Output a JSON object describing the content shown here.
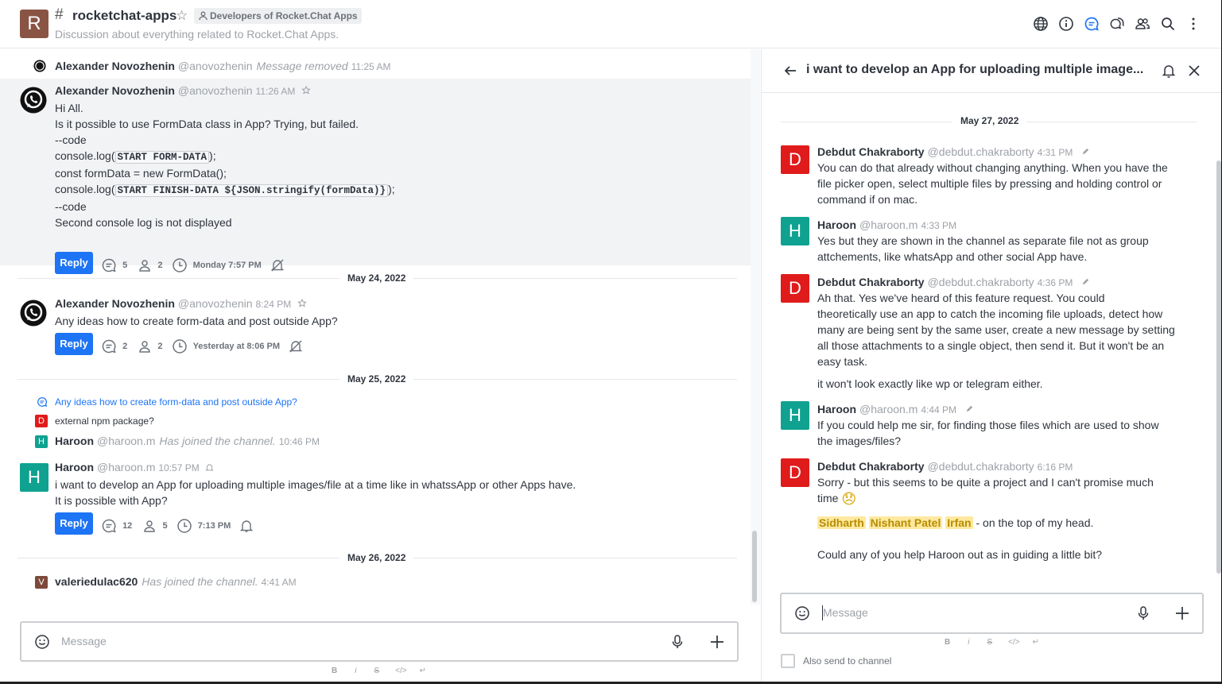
{
  "room": {
    "avatar_letter": "R",
    "name": "rocketchat-apps",
    "team": "Developers of Rocket.Chat Apps",
    "topic": "Discussion about everything related to Rocket.Chat Apps.",
    "header_icons": [
      "globe-icon",
      "info-icon",
      "threads-icon",
      "discussions-icon",
      "members-icon",
      "search-icon",
      "kebab-icon"
    ]
  },
  "main": {
    "messages": [
      {
        "name": "Alexander Novozhenin",
        "username": "@anovozhenin",
        "system": "Message removed",
        "time": "11:25 AM"
      },
      {
        "name": "Alexander Novozhenin",
        "username": "@anovozhenin",
        "time": "11:26 AM",
        "lines": [
          "Hi All.",
          "Is it possible to use FormData class in App? Trying, but failed.",
          "--code"
        ],
        "code1_pre": "console.log(",
        "code1": "START FORM-DATA",
        "code1_post": ");",
        "line_form": "const formData = new FormData();",
        "code2_pre": "console.log(",
        "code2": "START FINISH-DATA ${JSON.stringify(formData)}",
        "code2_post": ");",
        "lines2": [
          "--code",
          "Second console log is not displayed"
        ],
        "reply": "Reply",
        "replies": "5",
        "participants": "2",
        "last": "Monday 7:57 PM"
      },
      {
        "name": "Alexander Novozhenin",
        "username": "@anovozhenin",
        "time": "8:24 PM",
        "text": "Any ideas how to create form-data and post outside App?",
        "reply": "Reply",
        "replies": "2",
        "participants": "2",
        "last": "Yesterday at 8:06 PM"
      },
      {
        "thread_link": "Any ideas how to create form-data and post outside App?",
        "avatar_letter": "D",
        "text": "external npm package?"
      },
      {
        "avatar_letter": "H",
        "name": "Haroon",
        "username": "@haroon.m",
        "system": "Has joined the channel.",
        "time": "10:46 PM"
      },
      {
        "avatar_letter": "H",
        "name": "Haroon",
        "username": "@haroon.m",
        "time": "10:57 PM",
        "lines": [
          "i want to develop an App for uploading multiple images/file at a time like in whatssApp or other Apps have.",
          "It is possible with App?"
        ],
        "reply": "Reply",
        "replies": "12",
        "participants": "5",
        "last": "7:13 PM"
      },
      {
        "avatar_letter": "V",
        "name": "valeriedulac620",
        "system": "Has joined the channel.",
        "time": "4:41 AM"
      }
    ],
    "dividers": [
      "May 24, 2022",
      "May 25, 2022",
      "May 26, 2022"
    ],
    "composer_placeholder": "Message"
  },
  "thread": {
    "title": "i want to develop an App for uploading multiple image...",
    "date": "May 27, 2022",
    "messages": [
      {
        "avatar_letter": "D",
        "name": "Debdut Chakraborty",
        "username": "@debdut.chakraborty",
        "time": "4:31 PM",
        "lines": [
          "You can do that already without changing anything. When you have the",
          "file picker open, select multiple files by pressing and holding control or",
          "command if on mac."
        ]
      },
      {
        "avatar_letter": "H",
        "name": "Haroon",
        "username": "@haroon.m",
        "time": "4:33 PM",
        "lines": [
          "Yes but they are shown in the channel as separate file not as group",
          "attchements, like whatsApp and other social App have."
        ]
      },
      {
        "avatar_letter": "D",
        "name": "Debdut Chakraborty",
        "username": "@debdut.chakraborty",
        "time": "4:36 PM",
        "lines": [
          "Ah that. Yes we've heard of this feature request. You could",
          "theoretically use an app to catch the incoming file uploads, detect how",
          "many are being sent by the same user, create a new message by setting",
          "all those attachments to a single object, then send it. But it won't be an",
          "easy task."
        ],
        "extra": "it won't look exactly like wp or telegram either."
      },
      {
        "avatar_letter": "H",
        "name": "Haroon",
        "username": "@haroon.m",
        "time": "4:44 PM",
        "lines": [
          "If you could help me sir, for finding those files which are used to show",
          "the images/files?"
        ]
      },
      {
        "avatar_letter": "D",
        "name": "Debdut Chakraborty",
        "username": "@debdut.chakraborty",
        "time": "6:16 PM",
        "line1": "Sorry - but this seems to be quite a project and I can't promise much",
        "line2": "time",
        "emoji": "😞",
        "mentions": [
          "Sidharth",
          "Nishant Patel",
          "Irfan"
        ],
        "mention_tail": "- on the top of my head.",
        "last_line": "Could any of you help Haroon out as in guiding a little bit?"
      }
    ],
    "composer_placeholder": "Message",
    "also_send": "Also send to channel"
  },
  "format_bar": [
    "B",
    "i",
    "S",
    "</>",
    "↵"
  ],
  "colors": {
    "accent": "#1d74f5",
    "avatar_d": "#e01b1b",
    "avatar_h": "#10a290",
    "avatar_r": "#8a5444",
    "avatar_v": "#7d4a3a"
  }
}
